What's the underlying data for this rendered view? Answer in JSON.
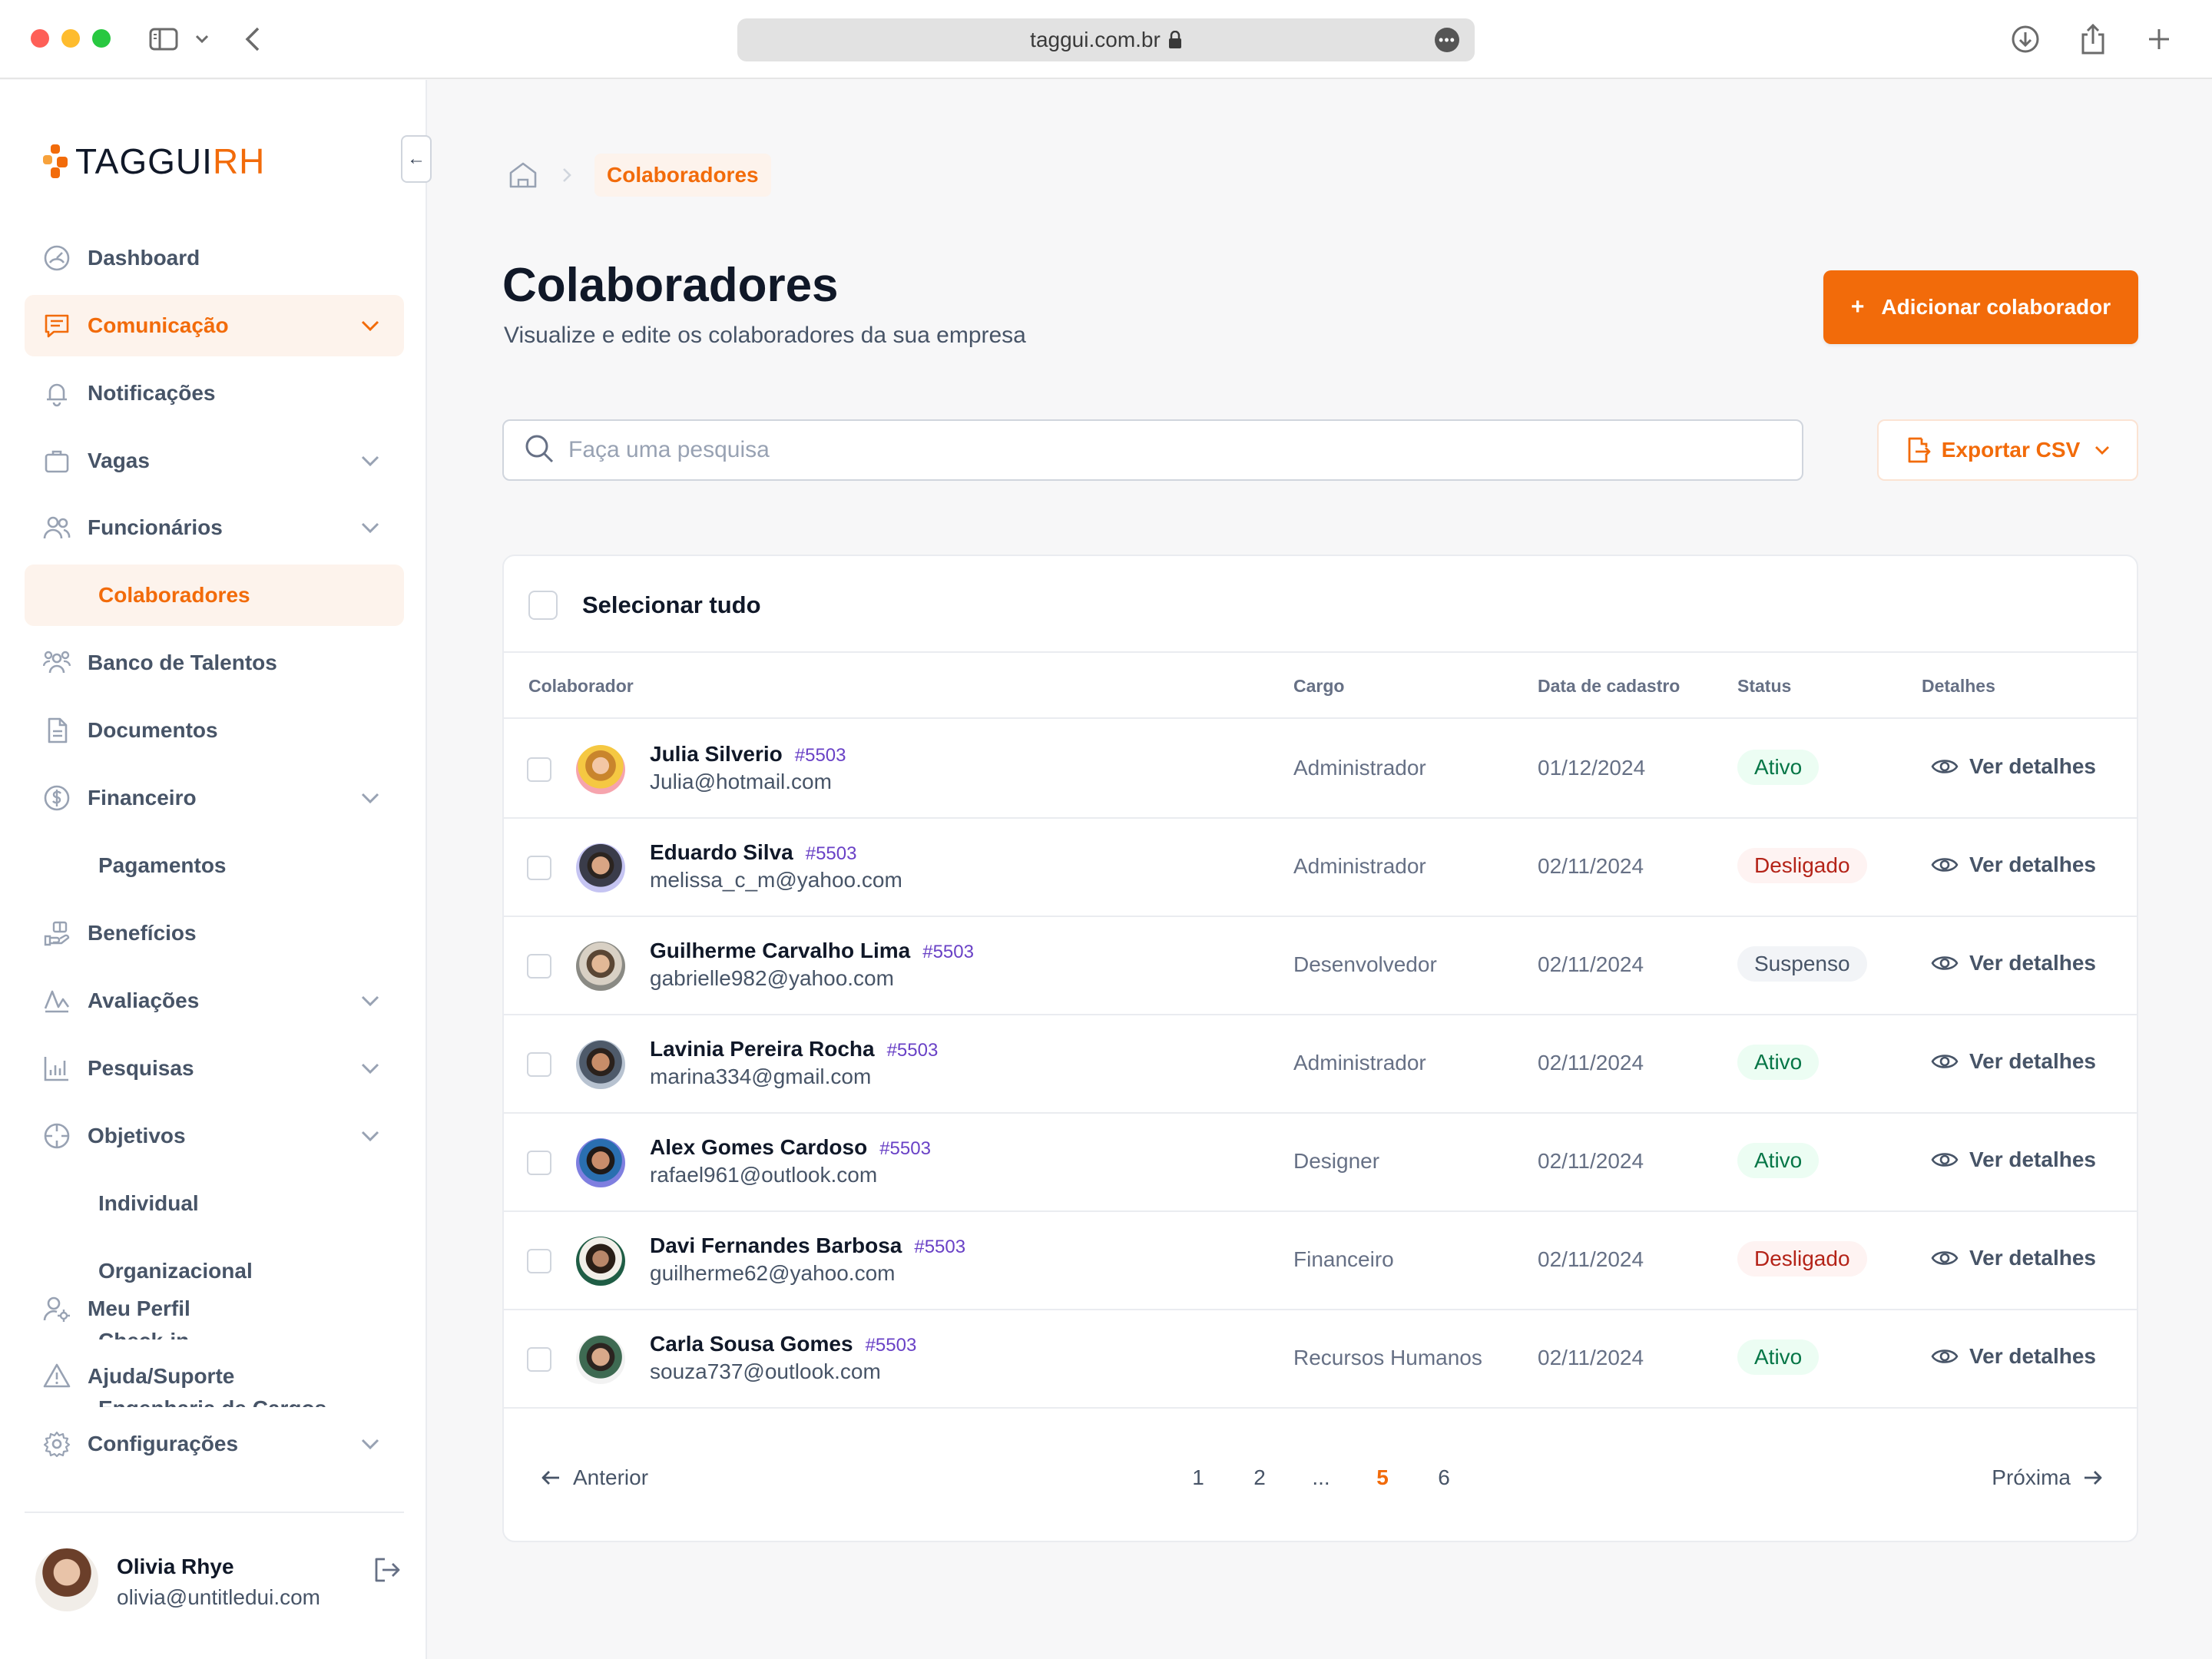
{
  "browser": {
    "url": "taggui.com.br"
  },
  "sidebar": {
    "logo": {
      "main": "TAGGUI",
      "accent": "RH"
    },
    "collapse_symbol": "←",
    "items": [
      {
        "label": "Dashboard",
        "icon": "gauge-icon",
        "expandable": false,
        "active": false
      },
      {
        "label": "Comunicação",
        "icon": "message-square-icon",
        "expandable": true,
        "active": true
      },
      {
        "label": "Notificações",
        "icon": "bell-icon",
        "expandable": false,
        "active": false
      },
      {
        "label": "Vagas",
        "icon": "briefcase-icon",
        "expandable": true,
        "active": false
      },
      {
        "label": "Funcionários",
        "icon": "users-icon",
        "expandable": true,
        "active": false
      },
      {
        "label": "Colaboradores",
        "sub": true,
        "active": true
      },
      {
        "label": "Banco de Talentos",
        "icon": "user-group-icon",
        "expandable": false,
        "active": false
      },
      {
        "label": "Documentos",
        "icon": "document-icon",
        "expandable": false,
        "active": false
      },
      {
        "label": "Financeiro",
        "icon": "dollar-circle-icon",
        "expandable": true,
        "active": false
      },
      {
        "label": "Pagamentos",
        "sub": true,
        "active": false
      },
      {
        "label": "Benefícios",
        "icon": "benefits-icon",
        "expandable": false,
        "active": false
      },
      {
        "label": "Avaliações",
        "icon": "activity-icon",
        "expandable": true,
        "active": false
      },
      {
        "label": "Pesquisas",
        "icon": "bar-chart-icon",
        "expandable": true,
        "active": false
      },
      {
        "label": "Objetivos",
        "icon": "target-icon",
        "expandable": true,
        "active": false
      },
      {
        "label": "Individual",
        "sub": true,
        "active": false
      },
      {
        "label": "Organizacional",
        "sub": true,
        "active": false
      },
      {
        "label": "Meu Perfil",
        "icon": "user-settings-icon",
        "expandable": false,
        "active": false
      },
      {
        "label": "Ajuda/Suporte",
        "icon": "help-alert-icon",
        "expandable": false,
        "active": false
      },
      {
        "label": "Configurações",
        "icon": "settings-gear-icon",
        "expandable": true,
        "active": false
      }
    ],
    "ghost_items": [
      "Check-in",
      "Engenharia de Cargos"
    ],
    "profile": {
      "name": "Olivia Rhye",
      "email": "olivia@untitledui.com"
    }
  },
  "breadcrumb": {
    "current": "Colaboradores"
  },
  "header": {
    "title": "Colaboradores",
    "subtitle": "Visualize e edite os colaboradores da sua empresa",
    "add_button": "Adicionar colaborador",
    "add_symbol": "+"
  },
  "search": {
    "placeholder": "Faça uma pesquisa",
    "value": ""
  },
  "export": {
    "label": "Exportar CSV"
  },
  "table": {
    "select_all": "Selecionar tudo",
    "columns": {
      "colaborador": "Colaborador",
      "cargo": "Cargo",
      "data": "Data de cadastro",
      "status": "Status",
      "detalhes": "Detalhes"
    },
    "detail_label": "Ver detalhes",
    "rows": [
      {
        "name": "Julia Silverio",
        "id": "#5503",
        "email": "Julia@hotmail.com",
        "cargo": "Administrador",
        "date": "01/12/2024",
        "status": "Ativo",
        "status_kind": "ativo",
        "avatar": "av1"
      },
      {
        "name": "Eduardo Silva",
        "id": "#5503",
        "email": "melissa_c_m@yahoo.com",
        "cargo": "Administrador",
        "date": "02/11/2024",
        "status": "Desligado",
        "status_kind": "desligado",
        "avatar": "av2"
      },
      {
        "name": "Guilherme Carvalho Lima",
        "id": "#5503",
        "email": "gabrielle982@yahoo.com",
        "cargo": "Desenvolvedor",
        "date": "02/11/2024",
        "status": "Suspenso",
        "status_kind": "suspenso",
        "avatar": "av3"
      },
      {
        "name": "Lavinia Pereira Rocha",
        "id": "#5503",
        "email": "marina334@gmail.com",
        "cargo": "Administrador",
        "date": "02/11/2024",
        "status": "Ativo",
        "status_kind": "ativo",
        "avatar": "av4"
      },
      {
        "name": "Alex Gomes Cardoso",
        "id": "#5503",
        "email": "rafael961@outlook.com",
        "cargo": "Designer",
        "date": "02/11/2024",
        "status": "Ativo",
        "status_kind": "ativo",
        "avatar": "av5"
      },
      {
        "name": "Davi Fernandes Barbosa",
        "id": "#5503",
        "email": "guilherme62@yahoo.com",
        "cargo": "Financeiro",
        "date": "02/11/2024",
        "status": "Desligado",
        "status_kind": "desligado",
        "avatar": "av6"
      },
      {
        "name": "Carla Sousa Gomes",
        "id": "#5503",
        "email": "souza737@outlook.com",
        "cargo": "Recursos Humanos",
        "date": "02/11/2024",
        "status": "Ativo",
        "status_kind": "ativo",
        "avatar": "av7"
      }
    ]
  },
  "pagination": {
    "prev": "Anterior",
    "next": "Próxima",
    "pages": [
      "1",
      "2",
      "...",
      "5",
      "6"
    ],
    "current": "5"
  },
  "colors": {
    "accent": "#f26b0a",
    "accent_soft": "#fdf3ec",
    "status_active": "#067647",
    "status_off": "#b42318",
    "status_suspended": "#475467",
    "id_purple": "#6941c6"
  }
}
